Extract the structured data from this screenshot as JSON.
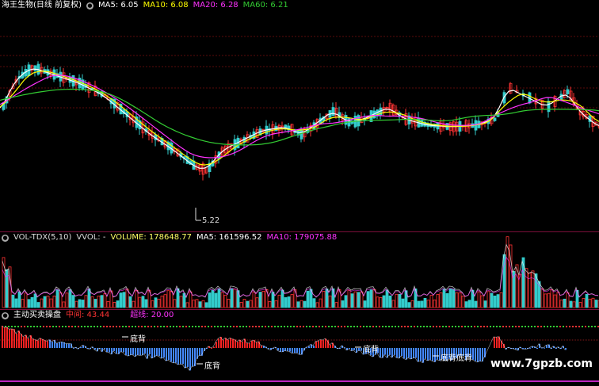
{
  "main": {
    "stock_label": "海王生物(日线 前复权)",
    "ma5": "MA5: 6.05",
    "ma10": "MA10: 6.08",
    "ma20": "MA20: 6.28",
    "ma60": "MA60: 6.21",
    "low_price": "5.22",
    "colors": {
      "ma5": "#ffffff",
      "ma10": "#ffff00",
      "ma20": "#ff33ff",
      "ma60": "#33cc33",
      "up": "#ff3333",
      "down": "#33cccc"
    }
  },
  "volume": {
    "indicator": "VOL-TDX(5,10)",
    "vvol": "VVOL: -",
    "volume": "VOLUME: 178648.77",
    "ma5": "MA5: 161596.52",
    "ma10": "MA10: 179075.88"
  },
  "flow": {
    "indicator": "主动买卖操盘",
    "mid_label": "中间: 43.44",
    "oversold": "超线: 20.00",
    "tags": [
      "底背",
      "底背",
      "底背",
      "底背底背"
    ]
  },
  "watermark": "www.7gpzb.com"
}
